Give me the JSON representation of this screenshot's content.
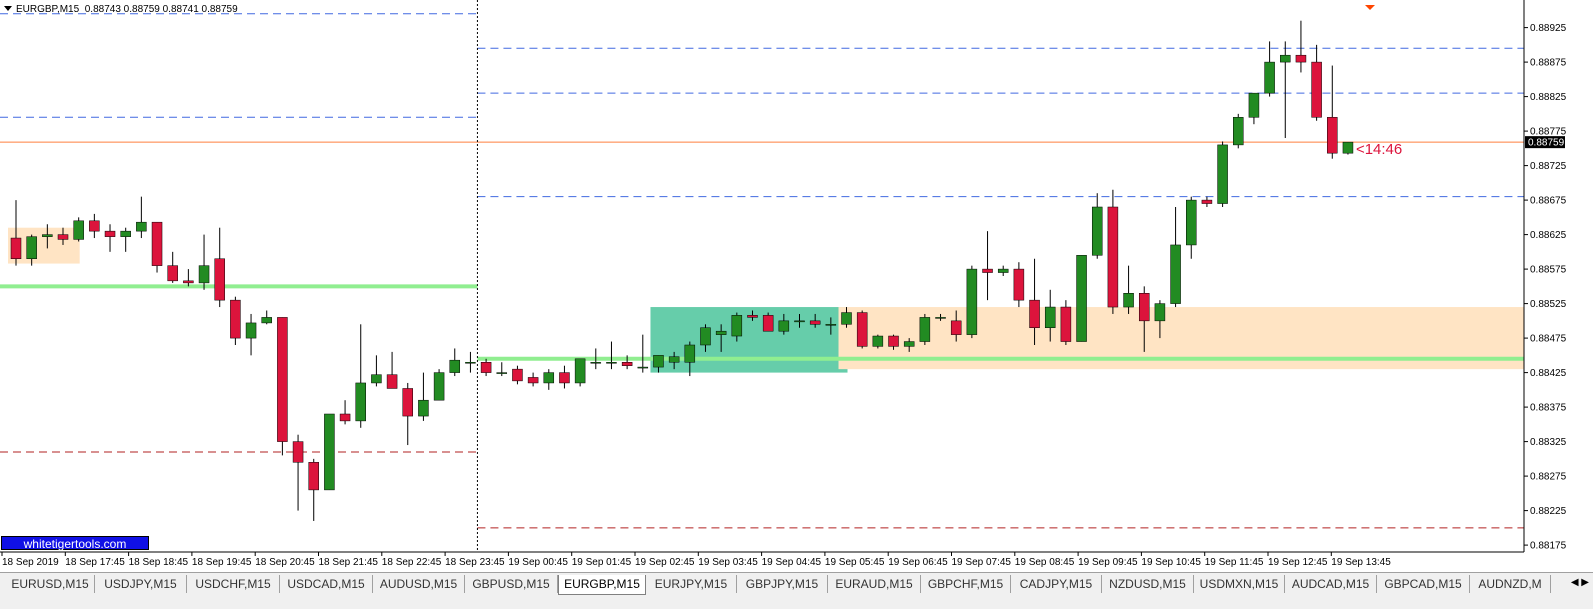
{
  "window": {
    "symbol_title": "EURGBP,M15",
    "ohlc_readout": "0.88743 0.88759 0.88741 0.88759",
    "watermark": "whitetigertools.com",
    "countdown": "<14:46"
  },
  "colors": {
    "bull": "#228b22",
    "bear": "#dc143c",
    "bid_line": "#ff7f3f",
    "resistance_line": "#4169e1",
    "support_line_red": "#b22222",
    "green_level": "#90ee90",
    "zone_peach": "#ffe4c4",
    "zone_teal": "#66cdaa",
    "price_marker_bg": "#000000"
  },
  "price_axis": {
    "min": 0.88165,
    "max": 0.88965,
    "ticks": [
      "0.88925",
      "0.88875",
      "0.88825",
      "0.88775",
      "0.88725",
      "0.88675",
      "0.88625",
      "0.88575",
      "0.88525",
      "0.88475",
      "0.88425",
      "0.88375",
      "0.88325",
      "0.88275",
      "0.88225",
      "0.88175"
    ],
    "current_price": "0.88759"
  },
  "time_axis": {
    "labels": [
      "18 Sep 2019",
      "18 Sep 17:45",
      "18 Sep 18:45",
      "18 Sep 19:45",
      "18 Sep 20:45",
      "18 Sep 21:45",
      "18 Sep 22:45",
      "18 Sep 23:45",
      "19 Sep 00:45",
      "19 Sep 01:45",
      "19 Sep 02:45",
      "19 Sep 03:45",
      "19 Sep 04:45",
      "19 Sep 05:45",
      "19 Sep 06:45",
      "19 Sep 07:45",
      "19 Sep 08:45",
      "19 Sep 09:45",
      "19 Sep 10:45",
      "19 Sep 11:45",
      "19 Sep 12:45",
      "19 Sep 13:45"
    ]
  },
  "chart_data": {
    "type": "candlestick",
    "timeframe": "M15",
    "candles": [
      {
        "o": 0.8862,
        "h": 0.88675,
        "l": 0.8858,
        "c": 0.8859
      },
      {
        "o": 0.8859,
        "h": 0.88625,
        "l": 0.8858,
        "c": 0.88622
      },
      {
        "o": 0.88622,
        "h": 0.8864,
        "l": 0.88605,
        "c": 0.88625
      },
      {
        "o": 0.88625,
        "h": 0.88635,
        "l": 0.8861,
        "c": 0.88618
      },
      {
        "o": 0.88618,
        "h": 0.8865,
        "l": 0.88615,
        "c": 0.88645
      },
      {
        "o": 0.88645,
        "h": 0.88655,
        "l": 0.8862,
        "c": 0.8863
      },
      {
        "o": 0.8863,
        "h": 0.8864,
        "l": 0.886,
        "c": 0.88622
      },
      {
        "o": 0.88622,
        "h": 0.88635,
        "l": 0.886,
        "c": 0.8863
      },
      {
        "o": 0.8863,
        "h": 0.8868,
        "l": 0.8862,
        "c": 0.88643
      },
      {
        "o": 0.88643,
        "h": 0.88643,
        "l": 0.8857,
        "c": 0.8858
      },
      {
        "o": 0.8858,
        "h": 0.886,
        "l": 0.88555,
        "c": 0.88558
      },
      {
        "o": 0.88558,
        "h": 0.88575,
        "l": 0.8855,
        "c": 0.88555
      },
      {
        "o": 0.88555,
        "h": 0.88625,
        "l": 0.88545,
        "c": 0.8858
      },
      {
        "o": 0.8859,
        "h": 0.88635,
        "l": 0.8852,
        "c": 0.8853
      },
      {
        "o": 0.8853,
        "h": 0.88535,
        "l": 0.88465,
        "c": 0.88475
      },
      {
        "o": 0.88475,
        "h": 0.8851,
        "l": 0.8845,
        "c": 0.88497
      },
      {
        "o": 0.88497,
        "h": 0.88515,
        "l": 0.88495,
        "c": 0.88505
      },
      {
        "o": 0.88505,
        "h": 0.88505,
        "l": 0.88305,
        "c": 0.88325
      },
      {
        "o": 0.88325,
        "h": 0.88335,
        "l": 0.88225,
        "c": 0.88295
      },
      {
        "o": 0.88295,
        "h": 0.883,
        "l": 0.8821,
        "c": 0.88255
      },
      {
        "o": 0.88255,
        "h": 0.88365,
        "l": 0.88255,
        "c": 0.88365
      },
      {
        "o": 0.88365,
        "h": 0.88385,
        "l": 0.8835,
        "c": 0.88355
      },
      {
        "o": 0.88355,
        "h": 0.88495,
        "l": 0.88345,
        "c": 0.8841
      },
      {
        "o": 0.8841,
        "h": 0.8845,
        "l": 0.88405,
        "c": 0.88422
      },
      {
        "o": 0.88422,
        "h": 0.88455,
        "l": 0.88405,
        "c": 0.88402
      },
      {
        "o": 0.88402,
        "h": 0.8841,
        "l": 0.8832,
        "c": 0.88362
      },
      {
        "o": 0.88362,
        "h": 0.88425,
        "l": 0.88355,
        "c": 0.88385
      },
      {
        "o": 0.88385,
        "h": 0.8843,
        "l": 0.88385,
        "c": 0.88425
      },
      {
        "o": 0.88425,
        "h": 0.8846,
        "l": 0.8842,
        "c": 0.88443
      },
      {
        "o": 0.8844,
        "h": 0.88455,
        "l": 0.88425,
        "c": 0.8844
      },
      {
        "o": 0.8844,
        "h": 0.88445,
        "l": 0.8842,
        "c": 0.88425
      },
      {
        "o": 0.88425,
        "h": 0.8844,
        "l": 0.8842,
        "c": 0.88425
      },
      {
        "o": 0.8843,
        "h": 0.88435,
        "l": 0.88408,
        "c": 0.88413
      },
      {
        "o": 0.88418,
        "h": 0.88425,
        "l": 0.88405,
        "c": 0.8841
      },
      {
        "o": 0.8841,
        "h": 0.8843,
        "l": 0.884,
        "c": 0.88425
      },
      {
        "o": 0.88425,
        "h": 0.88435,
        "l": 0.88402,
        "c": 0.8841
      },
      {
        "o": 0.8841,
        "h": 0.88445,
        "l": 0.88405,
        "c": 0.88445
      },
      {
        "o": 0.8844,
        "h": 0.8846,
        "l": 0.8843,
        "c": 0.8844
      },
      {
        "o": 0.8844,
        "h": 0.8847,
        "l": 0.8843,
        "c": 0.8844
      },
      {
        "o": 0.8844,
        "h": 0.8845,
        "l": 0.8843,
        "c": 0.88435
      },
      {
        "o": 0.88433,
        "h": 0.8848,
        "l": 0.88425,
        "c": 0.88433
      },
      {
        "o": 0.88433,
        "h": 0.8845,
        "l": 0.88425,
        "c": 0.8845
      },
      {
        "o": 0.8844,
        "h": 0.88455,
        "l": 0.8843,
        "c": 0.88448
      },
      {
        "o": 0.8844,
        "h": 0.8847,
        "l": 0.8842,
        "c": 0.88465
      },
      {
        "o": 0.88465,
        "h": 0.88495,
        "l": 0.88455,
        "c": 0.8849
      },
      {
        "o": 0.8848,
        "h": 0.88495,
        "l": 0.88455,
        "c": 0.88485
      },
      {
        "o": 0.88478,
        "h": 0.88512,
        "l": 0.8847,
        "c": 0.88508
      },
      {
        "o": 0.88508,
        "h": 0.88515,
        "l": 0.885,
        "c": 0.88505
      },
      {
        "o": 0.88508,
        "h": 0.88512,
        "l": 0.88485,
        "c": 0.88485
      },
      {
        "o": 0.88485,
        "h": 0.8851,
        "l": 0.8848,
        "c": 0.885
      },
      {
        "o": 0.885,
        "h": 0.8851,
        "l": 0.8849,
        "c": 0.885
      },
      {
        "o": 0.885,
        "h": 0.8851,
        "l": 0.8849,
        "c": 0.88495
      },
      {
        "o": 0.88495,
        "h": 0.88505,
        "l": 0.8848,
        "c": 0.88495
      },
      {
        "o": 0.88495,
        "h": 0.8852,
        "l": 0.8849,
        "c": 0.88512
      },
      {
        "o": 0.88512,
        "h": 0.88515,
        "l": 0.8846,
        "c": 0.88463
      },
      {
        "o": 0.88463,
        "h": 0.8848,
        "l": 0.8846,
        "c": 0.88478
      },
      {
        "o": 0.88478,
        "h": 0.8848,
        "l": 0.88458,
        "c": 0.88463
      },
      {
        "o": 0.88463,
        "h": 0.88475,
        "l": 0.88455,
        "c": 0.8847
      },
      {
        "o": 0.8847,
        "h": 0.8851,
        "l": 0.88465,
        "c": 0.88505
      },
      {
        "o": 0.88505,
        "h": 0.8851,
        "l": 0.885,
        "c": 0.88505
      },
      {
        "o": 0.885,
        "h": 0.88515,
        "l": 0.8847,
        "c": 0.8848
      },
      {
        "o": 0.8848,
        "h": 0.8858,
        "l": 0.88475,
        "c": 0.88575
      },
      {
        "o": 0.88575,
        "h": 0.8863,
        "l": 0.8853,
        "c": 0.8857
      },
      {
        "o": 0.8857,
        "h": 0.8858,
        "l": 0.88565,
        "c": 0.88575
      },
      {
        "o": 0.88575,
        "h": 0.88585,
        "l": 0.8852,
        "c": 0.8853
      },
      {
        "o": 0.8853,
        "h": 0.8859,
        "l": 0.88465,
        "c": 0.8849
      },
      {
        "o": 0.8849,
        "h": 0.88545,
        "l": 0.8847,
        "c": 0.8852
      },
      {
        "o": 0.8852,
        "h": 0.8853,
        "l": 0.88465,
        "c": 0.8847
      },
      {
        "o": 0.8847,
        "h": 0.88595,
        "l": 0.8847,
        "c": 0.88595
      },
      {
        "o": 0.88595,
        "h": 0.88685,
        "l": 0.8859,
        "c": 0.88665
      },
      {
        "o": 0.88665,
        "h": 0.8869,
        "l": 0.8851,
        "c": 0.8852
      },
      {
        "o": 0.8852,
        "h": 0.8858,
        "l": 0.8851,
        "c": 0.8854
      },
      {
        "o": 0.8854,
        "h": 0.8855,
        "l": 0.88455,
        "c": 0.885
      },
      {
        "o": 0.885,
        "h": 0.8853,
        "l": 0.88475,
        "c": 0.88525
      },
      {
        "o": 0.88525,
        "h": 0.88665,
        "l": 0.8852,
        "c": 0.8861
      },
      {
        "o": 0.8861,
        "h": 0.8868,
        "l": 0.8859,
        "c": 0.88675
      },
      {
        "o": 0.88675,
        "h": 0.8868,
        "l": 0.88665,
        "c": 0.8867
      },
      {
        "o": 0.8867,
        "h": 0.8876,
        "l": 0.88665,
        "c": 0.88755
      },
      {
        "o": 0.88755,
        "h": 0.888,
        "l": 0.8875,
        "c": 0.88795
      },
      {
        "o": 0.88795,
        "h": 0.8883,
        "l": 0.88785,
        "c": 0.8883
      },
      {
        "o": 0.8883,
        "h": 0.88905,
        "l": 0.88825,
        "c": 0.88875
      },
      {
        "o": 0.88875,
        "h": 0.88905,
        "l": 0.88765,
        "c": 0.88885
      },
      {
        "o": 0.88885,
        "h": 0.88935,
        "l": 0.8886,
        "c": 0.88875
      },
      {
        "o": 0.88875,
        "h": 0.889,
        "l": 0.8879,
        "c": 0.88795
      },
      {
        "o": 0.88795,
        "h": 0.8887,
        "l": 0.88735,
        "c": 0.88743
      },
      {
        "o": 0.88743,
        "h": 0.88759,
        "l": 0.88741,
        "c": 0.88759
      }
    ],
    "horizontal_levels": [
      {
        "kind": "resistance",
        "style": "dashed",
        "price": 0.88945,
        "range": "left"
      },
      {
        "kind": "resistance",
        "style": "dashed",
        "price": 0.88795,
        "range": "left"
      },
      {
        "kind": "support",
        "style": "dashed",
        "price": 0.8831,
        "range": "left"
      },
      {
        "kind": "resistance",
        "style": "dashed",
        "price": 0.88895,
        "range": "right"
      },
      {
        "kind": "resistance",
        "style": "dashed",
        "price": 0.8883,
        "range": "right"
      },
      {
        "kind": "resistance",
        "style": "dashed",
        "price": 0.8868,
        "range": "right"
      },
      {
        "kind": "support",
        "style": "dashed",
        "price": 0.882,
        "range": "right"
      },
      {
        "kind": "level",
        "style": "solid-thick",
        "price": 0.8855,
        "range": "left"
      },
      {
        "kind": "level",
        "style": "solid-thick",
        "price": 0.88445,
        "range": "right"
      },
      {
        "kind": "bid",
        "style": "solid",
        "price": 0.88759,
        "range": "full"
      }
    ],
    "zones": [
      {
        "color": "peach",
        "from_index": 0,
        "to_index": 4,
        "high": 0.88635,
        "low": 0.88583
      },
      {
        "color": "teal",
        "from_index": 41,
        "to_index": 53,
        "high": 0.8852,
        "low": 0.88425
      },
      {
        "color": "peach",
        "from_index": 53,
        "to_index": 86,
        "high": 0.8852,
        "low": 0.8843
      }
    ],
    "period_separator_index": 29
  },
  "tabs": [
    {
      "label": "EURUSD,M15",
      "active": false
    },
    {
      "label": "USDJPY,M15",
      "active": false
    },
    {
      "label": "USDCHF,M15",
      "active": false
    },
    {
      "label": "USDCAD,M15",
      "active": false
    },
    {
      "label": "AUDUSD,M15",
      "active": false
    },
    {
      "label": "GBPUSD,M15",
      "active": false
    },
    {
      "label": "EURGBP,M15",
      "active": true
    },
    {
      "label": "EURJPY,M15",
      "active": false
    },
    {
      "label": "GBPJPY,M15",
      "active": false
    },
    {
      "label": "EURAUD,M15",
      "active": false
    },
    {
      "label": "GBPCHF,M15",
      "active": false
    },
    {
      "label": "CADJPY,M15",
      "active": false
    },
    {
      "label": "NZDUSD,M15",
      "active": false
    },
    {
      "label": "USDMXN,M15",
      "active": false
    },
    {
      "label": "AUDCAD,M15",
      "active": false
    },
    {
      "label": "GBPCAD,M15",
      "active": false
    },
    {
      "label": "AUDNZD,M",
      "active": false
    }
  ],
  "tab_scroll_icons": [
    "arrow-left-icon",
    "arrow-right-icon"
  ]
}
